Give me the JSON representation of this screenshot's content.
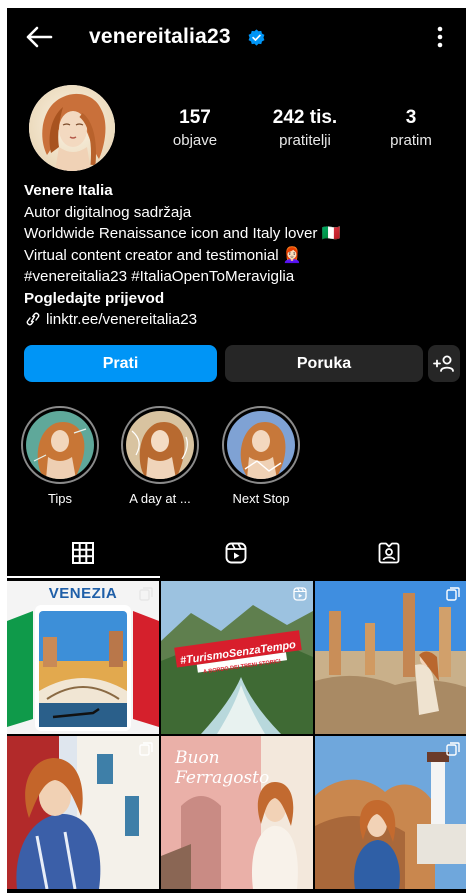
{
  "profile": {
    "username": "venereitalia23",
    "stats": {
      "posts": {
        "value": "157",
        "label": "objave"
      },
      "followers": {
        "value": "242 tis.",
        "label": "pratitelji"
      },
      "following": {
        "value": "3",
        "label": "pratim"
      }
    },
    "bio": {
      "name": "Venere Italia",
      "category": "Autor digitalnog sadržaja",
      "line1": "Worldwide Renaissance icon and Italy lover 🇮🇹",
      "line2": "Virtual content creator and testimonial 👩🏻‍🦰",
      "hashtags": "#venereitalia23 #ItaliaOpenToMeraviglia",
      "translate": "Pogledajte prijevod",
      "link": "linktr.ee/venereitalia23"
    }
  },
  "actions": {
    "follow": "Prati",
    "message": "Poruka",
    "suggest_icon": "add-person-icon"
  },
  "highlights": [
    {
      "label": "Tips"
    },
    {
      "label": "A day at ..."
    },
    {
      "label": "Next Stop"
    }
  ],
  "tabs": [
    {
      "icon": "grid-icon",
      "active": true
    },
    {
      "icon": "reels-icon",
      "active": false
    },
    {
      "icon": "tagged-icon",
      "active": false
    }
  ],
  "posts": [
    {
      "overlay_text": "VENEZIA"
    },
    {
      "overlay_text": "#TurismoSenzaTempo",
      "overlay_subtext": "A BORDO DEI TRENI STORICI"
    },
    {
      "overlay_text": ""
    },
    {
      "overlay_text": ""
    },
    {
      "overlay_text": "Buon Ferragosto"
    },
    {
      "overlay_text": ""
    }
  ],
  "colors": {
    "background": "#000000",
    "accent": "#0095f6",
    "secondary_button": "#262626",
    "verified": "#0095f6"
  }
}
